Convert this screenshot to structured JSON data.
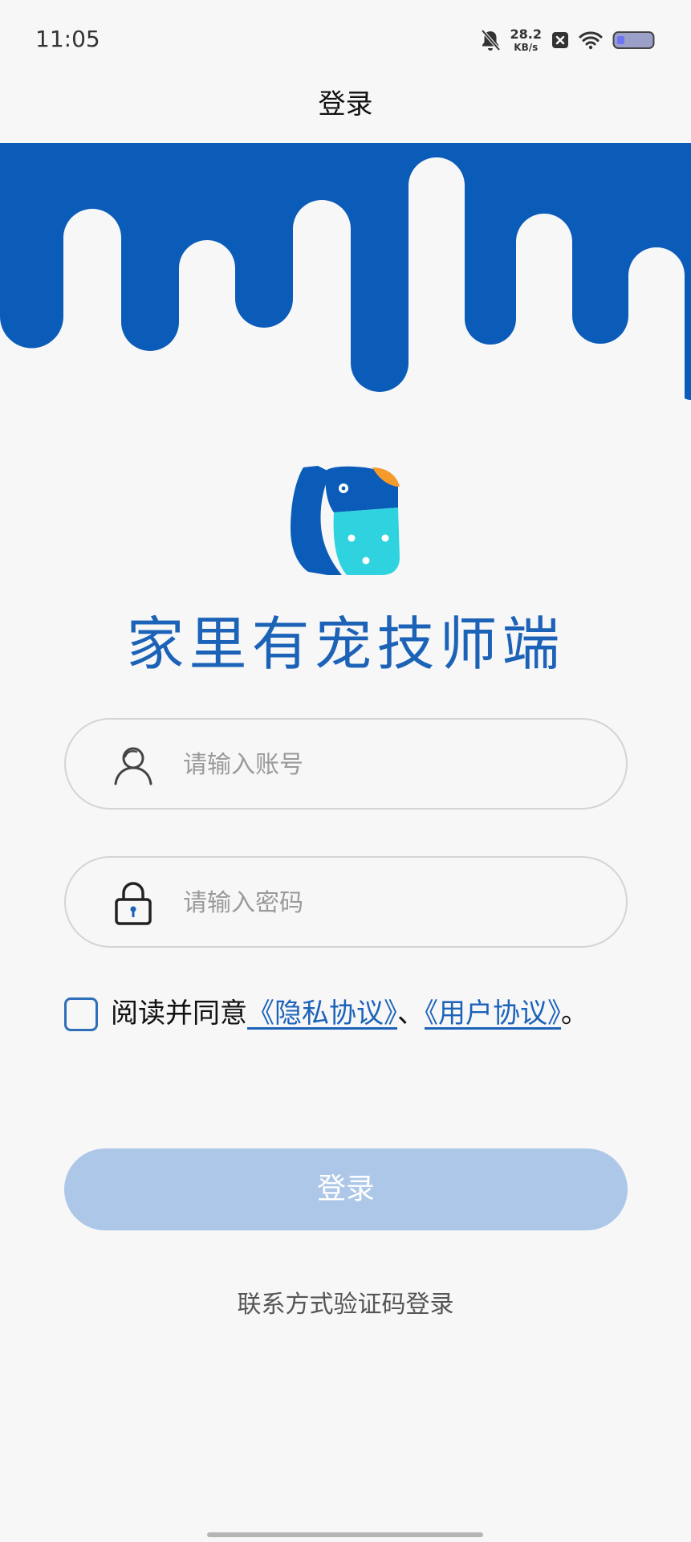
{
  "status_bar": {
    "time": "11:05",
    "net_speed_value": "28.2",
    "net_speed_unit": "KB/s",
    "icons": [
      "bell-muted-icon",
      "close-box-icon",
      "wifi-icon",
      "battery-icon"
    ]
  },
  "nav": {
    "title": "登录"
  },
  "brand": {
    "title": "家里有宠技师端",
    "primary_color": "#0a5cb8",
    "accent_cyan": "#2fd3df",
    "accent_orange": "#f59b2b"
  },
  "form": {
    "account_placeholder": "请输入账号",
    "password_placeholder": "请输入密码",
    "agreement_prefix": "阅读并同意",
    "privacy_link": "《隐私协议》",
    "separator": "、",
    "user_link": "《用户协议》",
    "suffix": "。",
    "agreement_checked": false,
    "login_button": "登录",
    "alt_login": "联系方式验证码登录"
  }
}
